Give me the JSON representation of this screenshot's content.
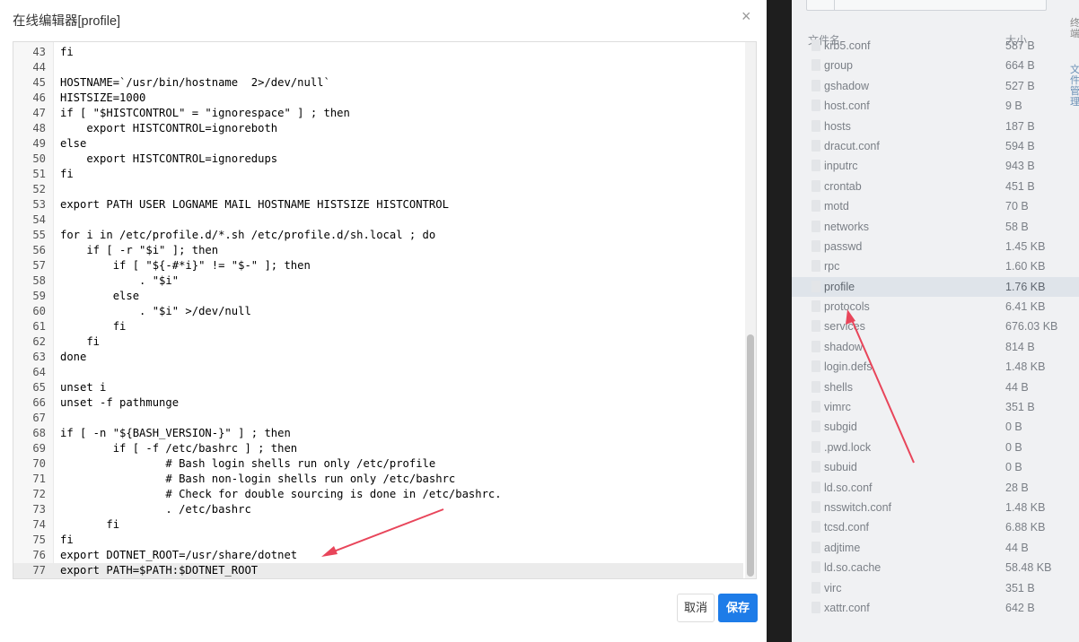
{
  "modal": {
    "title": "在线编辑器[profile]",
    "close_icon": "×",
    "cancel_label": "取消",
    "save_label": "保存"
  },
  "editor": {
    "lines": [
      {
        "n": "43",
        "t": "fi"
      },
      {
        "n": "44",
        "t": ""
      },
      {
        "n": "45",
        "t": "HOSTNAME=`/usr/bin/hostname  2>/dev/null`"
      },
      {
        "n": "46",
        "t": "HISTSIZE=1000"
      },
      {
        "n": "47",
        "t": "if [ \"$HISTCONTROL\" = \"ignorespace\" ] ; then"
      },
      {
        "n": "48",
        "t": "    export HISTCONTROL=ignoreboth"
      },
      {
        "n": "49",
        "t": "else"
      },
      {
        "n": "50",
        "t": "    export HISTCONTROL=ignoredups"
      },
      {
        "n": "51",
        "t": "fi"
      },
      {
        "n": "52",
        "t": ""
      },
      {
        "n": "53",
        "t": "export PATH USER LOGNAME MAIL HOSTNAME HISTSIZE HISTCONTROL"
      },
      {
        "n": "54",
        "t": ""
      },
      {
        "n": "55",
        "t": "for i in /etc/profile.d/*.sh /etc/profile.d/sh.local ; do"
      },
      {
        "n": "56",
        "t": "    if [ -r \"$i\" ]; then"
      },
      {
        "n": "57",
        "t": "        if [ \"${-#*i}\" != \"$-\" ]; then"
      },
      {
        "n": "58",
        "t": "            . \"$i\""
      },
      {
        "n": "59",
        "t": "        else"
      },
      {
        "n": "60",
        "t": "            . \"$i\" >/dev/null"
      },
      {
        "n": "61",
        "t": "        fi"
      },
      {
        "n": "62",
        "t": "    fi"
      },
      {
        "n": "63",
        "t": "done"
      },
      {
        "n": "64",
        "t": ""
      },
      {
        "n": "65",
        "t": "unset i"
      },
      {
        "n": "66",
        "t": "unset -f pathmunge"
      },
      {
        "n": "67",
        "t": ""
      },
      {
        "n": "68",
        "t": "if [ -n \"${BASH_VERSION-}\" ] ; then"
      },
      {
        "n": "69",
        "t": "        if [ -f /etc/bashrc ] ; then"
      },
      {
        "n": "70",
        "t": "                # Bash login shells run only /etc/profile"
      },
      {
        "n": "71",
        "t": "                # Bash non-login shells run only /etc/bashrc"
      },
      {
        "n": "72",
        "t": "                # Check for double sourcing is done in /etc/bashrc."
      },
      {
        "n": "73",
        "t": "                . /etc/bashrc"
      },
      {
        "n": "74",
        "t": "       fi"
      },
      {
        "n": "75",
        "t": "fi"
      },
      {
        "n": "76",
        "t": "export DOTNET_ROOT=/usr/share/dotnet"
      },
      {
        "n": "77",
        "t": "export PATH=$PATH:$DOTNET_ROOT",
        "active": true
      }
    ]
  },
  "file_manager": {
    "header_name": "文件名",
    "header_size": "大小",
    "files": [
      {
        "name": "krb5.conf",
        "size": "587 B"
      },
      {
        "name": "group",
        "size": "664 B"
      },
      {
        "name": "gshadow",
        "size": "527 B"
      },
      {
        "name": "host.conf",
        "size": "9 B"
      },
      {
        "name": "hosts",
        "size": "187 B"
      },
      {
        "name": "dracut.conf",
        "size": "594 B"
      },
      {
        "name": "inputrc",
        "size": "943 B"
      },
      {
        "name": "crontab",
        "size": "451 B"
      },
      {
        "name": "motd",
        "size": "70 B"
      },
      {
        "name": "networks",
        "size": "58 B"
      },
      {
        "name": "passwd",
        "size": "1.45 KB"
      },
      {
        "name": "rpc",
        "size": "1.60 KB"
      },
      {
        "name": "profile",
        "size": "1.76 KB",
        "selected": true
      },
      {
        "name": "protocols",
        "size": "6.41 KB"
      },
      {
        "name": "services",
        "size": "676.03 KB"
      },
      {
        "name": "shadow",
        "size": "814 B"
      },
      {
        "name": "login.defs",
        "size": "1.48 KB"
      },
      {
        "name": "shells",
        "size": "44 B"
      },
      {
        "name": "vimrc",
        "size": "351 B"
      },
      {
        "name": "subgid",
        "size": "0 B"
      },
      {
        "name": ".pwd.lock",
        "size": "0 B"
      },
      {
        "name": "subuid",
        "size": "0 B"
      },
      {
        "name": "ld.so.conf",
        "size": "28 B"
      },
      {
        "name": "nsswitch.conf",
        "size": "1.48 KB"
      },
      {
        "name": "tcsd.conf",
        "size": "6.88 KB"
      },
      {
        "name": "adjtime",
        "size": "44 B"
      },
      {
        "name": "ld.so.cache",
        "size": "58.48 KB"
      },
      {
        "name": "virc",
        "size": "351 B"
      },
      {
        "name": "xattr.conf",
        "size": "642 B"
      }
    ],
    "side_labels": [
      "终端",
      "文件管理"
    ]
  },
  "colors": {
    "accent": "#1e7ce8",
    "annotation_arrow": "#e8455a"
  }
}
